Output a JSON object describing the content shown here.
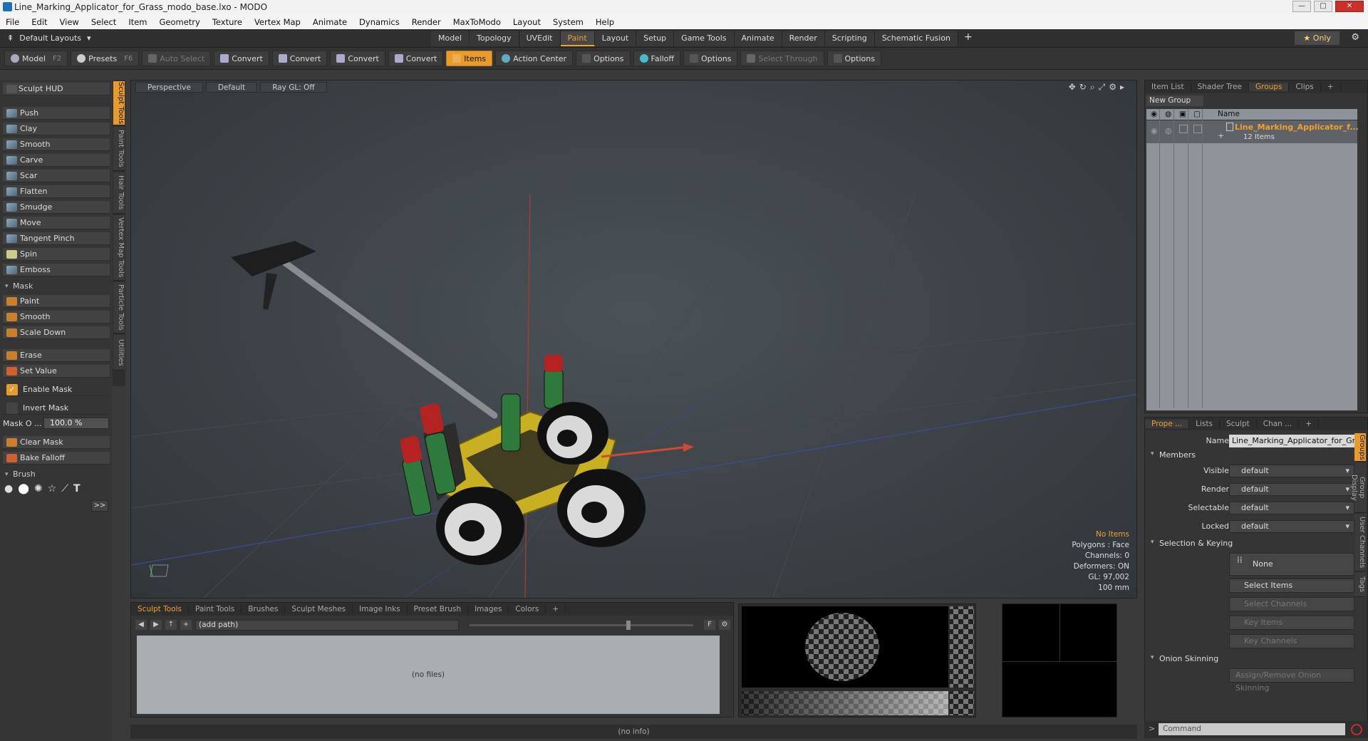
{
  "window": {
    "title": "Line_Marking_Applicator_for_Grass_modo_base.lxo - MODO"
  },
  "menu": [
    "File",
    "Edit",
    "View",
    "Select",
    "Item",
    "Geometry",
    "Texture",
    "Vertex Map",
    "Animate",
    "Dynamics",
    "Render",
    "MaxToModo",
    "Layout",
    "System",
    "Help"
  ],
  "layout": {
    "selector": "Default Layouts",
    "tabs": [
      "Model",
      "Topology",
      "UVEdit",
      "Paint",
      "Layout",
      "Setup",
      "Game Tools",
      "Animate",
      "Render",
      "Scripting",
      "Schematic Fusion"
    ],
    "active_tab": "Paint",
    "only_label": "Only"
  },
  "toolbar": {
    "model": "Model",
    "model_key": "F2",
    "presets": "Presets",
    "presets_key": "F6",
    "auto_select": "Auto Select",
    "convert1": "Convert",
    "convert2": "Convert",
    "convert3": "Convert",
    "convert4": "Convert",
    "items": "Items",
    "action_center": "Action Center",
    "options1": "Options",
    "falloff": "Falloff",
    "options2": "Options",
    "select_through": "Select Through",
    "options3": "Options"
  },
  "left": {
    "sculpt_hud": "Sculpt HUD",
    "tools": [
      "Push",
      "Clay",
      "Smooth",
      "Carve",
      "Scar",
      "Flatten",
      "Smudge",
      "Move",
      "Tangent Pinch",
      "Spin",
      "Emboss"
    ],
    "mask_section": "Mask",
    "mask_tools": [
      "Paint",
      "Smooth",
      "Scale Down"
    ],
    "erase": "Erase",
    "set_value": "Set Value",
    "enable_mask": "Enable Mask",
    "invert_mask": "Invert Mask",
    "mask_opacity_label": "Mask O ...",
    "mask_opacity_value": "100.0 %",
    "clear_mask": "Clear Mask",
    "bake_falloff": "Bake Falloff",
    "brush_section": "Brush",
    "more": ">>"
  },
  "vtabs": [
    "Sculpt Tools",
    "Paint Tools",
    "Hair Tools",
    "Vertex Map Tools",
    "Particle Tools",
    "Utilities"
  ],
  "viewport": {
    "view": "Perspective",
    "shading": "Default",
    "raygl": "Ray GL: Off",
    "info": {
      "items": "No Items",
      "polygons": "Polygons : Face",
      "channels": "Channels: 0",
      "deformers": "Deformers: ON",
      "gl": "GL: 97,002",
      "scale": "100 mm"
    }
  },
  "bottom": {
    "tabs": [
      "Sculpt Tools",
      "Paint Tools",
      "Brushes",
      "Sculpt Meshes",
      "Image Inks",
      "Preset Brush",
      "Images",
      "Colors"
    ],
    "path": "(add path)",
    "empty": "(no files)",
    "f_label": "F",
    "status": "(no info)"
  },
  "right_top": {
    "tabs": [
      "Item List",
      "Shader Tree",
      "Groups",
      "Clips"
    ],
    "active": "Groups",
    "new_group": "New Group",
    "name_col": "Name",
    "group_name": "Line_Marking_Applicator_f...",
    "group_count": "12 Items"
  },
  "right_bottom": {
    "tabs": [
      "Prope ...",
      "Lists",
      "Sculpt",
      "Chan ..."
    ],
    "name_label": "Name",
    "name_value": "Line_Marking_Applicator_for_Gras",
    "members": "Members",
    "visible_label": "Visible",
    "visible": "default",
    "render_label": "Render",
    "render": "default",
    "selectable_label": "Selectable",
    "selectable": "default",
    "locked_label": "Locked",
    "locked": "default",
    "sel_keying": "Selection & Keying",
    "none": "None",
    "select_items": "Select Items",
    "select_channels": "Select Channels",
    "key_items": "Key Items",
    "key_channels": "Key Channels",
    "onion": "Onion Skinning",
    "assign_onion": "Assign/Remove Onion Skinning",
    "side_tabs": [
      "Groups",
      "Group Display",
      "User Channels",
      "Tags"
    ]
  },
  "command": {
    "placeholder": "Command"
  }
}
